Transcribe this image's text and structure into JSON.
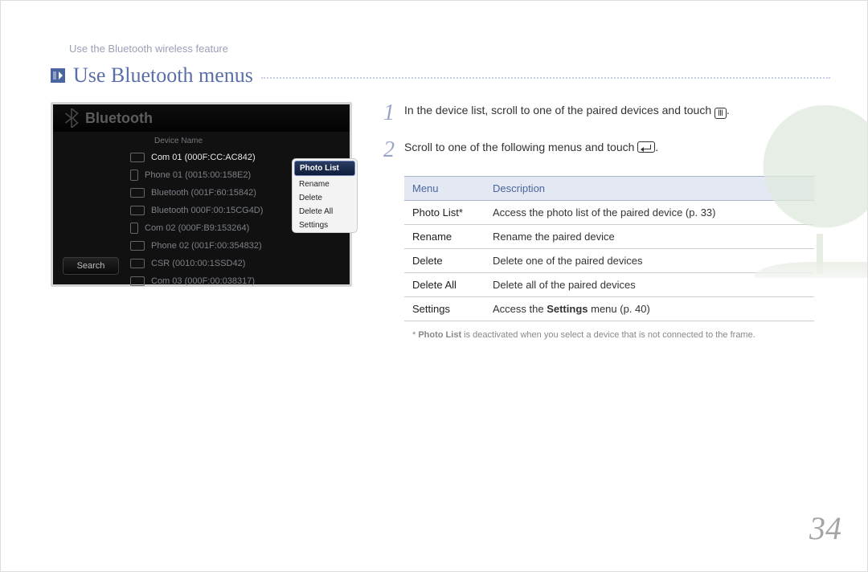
{
  "breadcrumb": "Use the Bluetooth wireless feature",
  "title": "Use Bluetooth menus",
  "page_number": "34",
  "screenshot": {
    "window_title": "Bluetooth",
    "column_header": "Device Name",
    "search_label": "Search",
    "devices": [
      {
        "icon": "pc",
        "label": "Com 01 (000F:CC:AC842)"
      },
      {
        "icon": "phone",
        "label": "Phone 01 (0015:00:158E2)"
      },
      {
        "icon": "pc",
        "label": "Bluetooth (001F:60:15842)"
      },
      {
        "icon": "pc",
        "label": "Bluetooth 000F:00:15CG4D)"
      },
      {
        "icon": "phone",
        "label": "Com 02 (000F:B9:153264)"
      },
      {
        "icon": "pc",
        "label": "Phone 02 (001F:00:354832)"
      },
      {
        "icon": "pc",
        "label": "CSR (0010:00:1SSD42)"
      },
      {
        "icon": "pc",
        "label": "Com 03 (000F:00:038317)"
      }
    ],
    "context_items": [
      "Photo List",
      "Rename",
      "Delete",
      "Delete All",
      "Settings"
    ]
  },
  "steps": {
    "s1": "In the device list, scroll to one of the paired devices and touch ",
    "s1_after": ".",
    "s2": "Scroll to one of the following menus and touch ",
    "s2_after": "."
  },
  "table": {
    "head_menu": "Menu",
    "head_desc": "Description",
    "rows": [
      {
        "menu": "Photo List*",
        "desc": "Access the photo list of the paired device (p. 33)"
      },
      {
        "menu": "Rename",
        "desc": "Rename the paired device"
      },
      {
        "menu": "Delete",
        "desc": "Delete one of the paired devices"
      },
      {
        "menu": "Delete All",
        "desc": "Delete all of the paired devices"
      },
      {
        "menu": "Settings",
        "desc_pre": "Access the ",
        "desc_bold": "Settings",
        "desc_post": " menu (p. 40)"
      }
    ]
  },
  "footnote": {
    "star": "*",
    "lead": " Photo List",
    "rest": " is deactivated when you select a device that is not connected to the frame."
  }
}
